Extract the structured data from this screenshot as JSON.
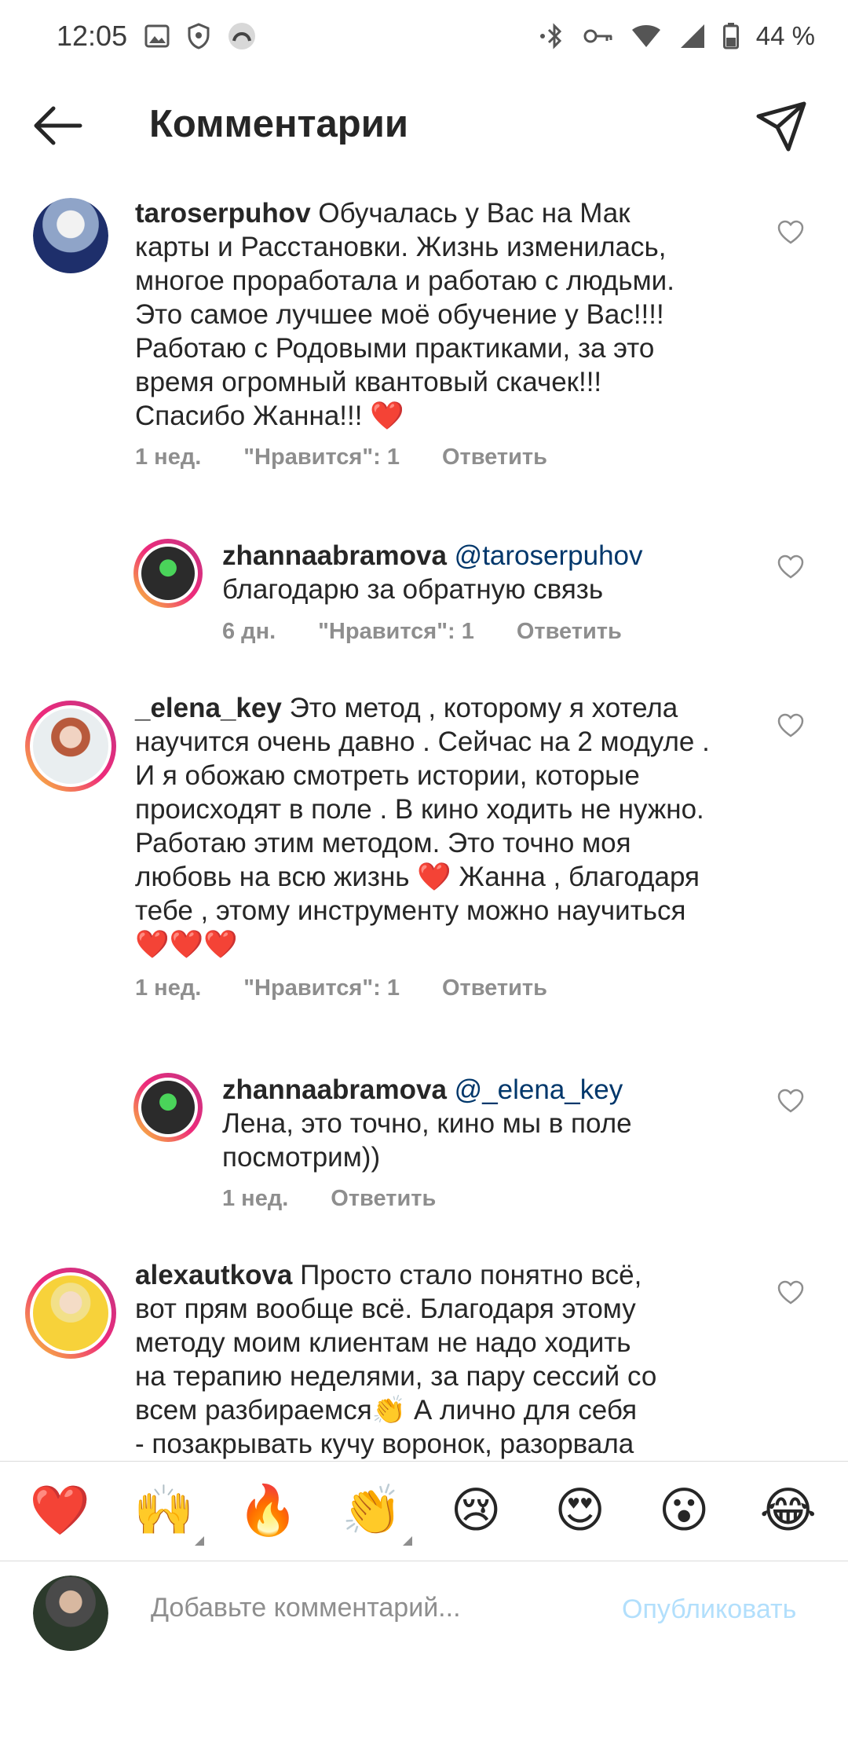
{
  "status_bar": {
    "time": "12:05",
    "battery": "44 %"
  },
  "header": {
    "title": "Комментарии"
  },
  "comments": [
    {
      "username": "taroserpuhov",
      "lines": [
        "Обучалась у Вас на Мак",
        "карты и Расстановки. Жизнь изменилась,",
        "многое проработала и работаю с людьми.",
        "Это самое лучшее моё обучение у Вас!!!!",
        "Работаю с Родовыми практиками, за это",
        "время огромный квантовый скачек!!!",
        "Спасибо Жанна!!! ❤️"
      ],
      "time": "1 нед.",
      "likes": "\"Нравится\": 1",
      "reply": "Ответить"
    },
    {
      "username": "zhannaabramova",
      "mention": "@taroserpuhov",
      "lines": [
        "благодарю за обратную связь"
      ],
      "time": "6 дн.",
      "likes": "\"Нравится\": 1",
      "reply": "Ответить"
    },
    {
      "username": "_elena_key",
      "lines": [
        "Это метод , которому я хотела",
        "научится очень давно . Сейчас на 2 модуле .",
        "И я обожаю смотреть истории, которые",
        "происходят в поле . В кино ходить не нужно.",
        "Работаю этим методом. Это точно моя",
        "любовь на всю жизнь ❤️ Жанна , благодаря",
        "тебе , этому инструменту можно научиться",
        "❤️❤️❤️"
      ],
      "time": "1 нед.",
      "likes": "\"Нравится\": 1",
      "reply": "Ответить"
    },
    {
      "username": "zhannaabramova",
      "mention": "@_elena_key",
      "lines": [
        "Лена, это точно, кино мы в поле",
        "посмотрим))"
      ],
      "time": "1 нед.",
      "reply": "Ответить"
    },
    {
      "username": "alexautkova",
      "lines": [
        "Просто стало понятно всё,",
        "вот прям вообще всё. Благодаря этому",
        "методу моим клиентам не надо ходить",
        "на терапию неделями, за пару сессий со",
        "всем разбираемся👏 А лично для себя",
        "- позакрывать кучу воронок, разорвала"
      ]
    }
  ],
  "emoji_bar": [
    "❤️",
    "🙌",
    "🔥",
    "👏",
    "😢",
    "😍",
    "😮",
    "😂"
  ],
  "composer": {
    "placeholder": "Добавьте комментарий...",
    "publish_label": "Опубликовать"
  },
  "colors": {
    "text": "#262626",
    "meta": "#8e8e8e",
    "mention": "#00376b",
    "publish_disabled": "#b2dffc"
  },
  "icons": [
    "back-arrow-icon",
    "direct-send-icon",
    "heart-outline-icon",
    "gallery-icon",
    "shield-icon",
    "bluetooth-icon",
    "key-icon",
    "wifi-icon",
    "signal-icon",
    "battery-icon"
  ]
}
